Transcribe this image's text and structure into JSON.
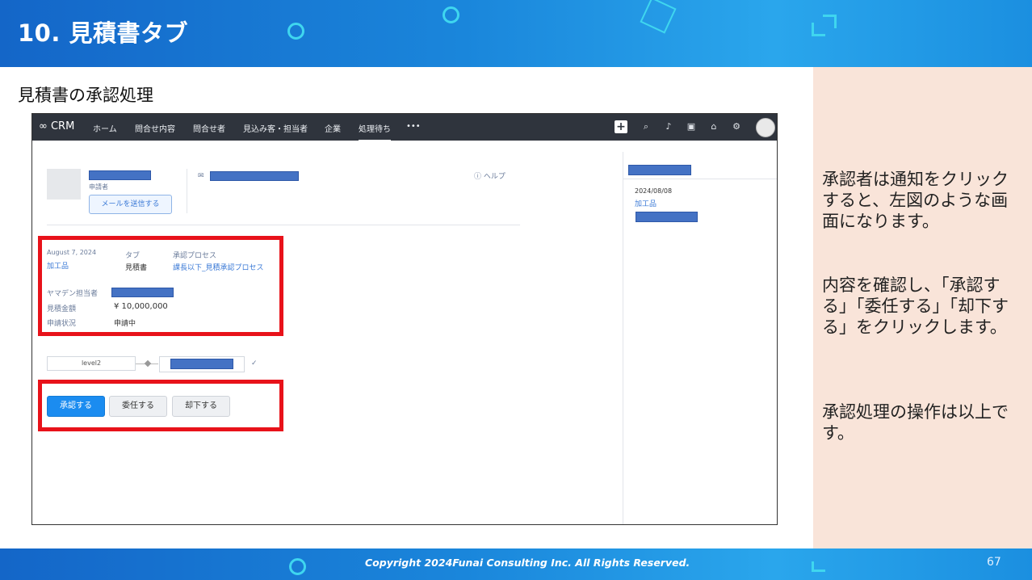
{
  "slide": {
    "title": "10. 見積書タブ",
    "subtitle": "見積書の承認処理",
    "copyright": "Copyright 2024Funai Consulting Inc. All Rights Reserved.",
    "page_number": "67"
  },
  "notes": [
    "承認者は通知をクリックすると、左図のような画面になります。",
    "内容を確認し、「承認する」「委任する」「却下する」をクリックします。",
    "承認処理の操作は以上です。"
  ],
  "crm": {
    "logo": "CRM",
    "nav_items": [
      "ホーム",
      "問合せ内容",
      "問合せ者",
      "見込み客・担当者",
      "企業",
      "処理待ち"
    ],
    "more": "•••",
    "icons": [
      "plus-icon",
      "search-icon",
      "bell-icon",
      "tablet-icon",
      "store-icon",
      "gear-icon",
      "avatar"
    ],
    "requester_label": "申請者",
    "send_mail_button": "メールを送信する",
    "help": "ヘルプ",
    "details": {
      "date": "August 7, 2024",
      "category": "加工品",
      "tab_label": "タブ",
      "tab_value": "見積書",
      "process_label": "承認プロセス",
      "process_value": "課長以下_見積承認プロセス",
      "staff_label": "ヤマデン担当者",
      "amount_label": "見積金額",
      "amount_value": "¥ 10,000,000",
      "status_label": "申請状況",
      "status_value": "申請中"
    },
    "flow_level": "level2",
    "actions": {
      "approve": "承認する",
      "delegate": "委任する",
      "reject": "却下する"
    },
    "side": {
      "date": "2024/08/08",
      "category": "加工品"
    }
  }
}
